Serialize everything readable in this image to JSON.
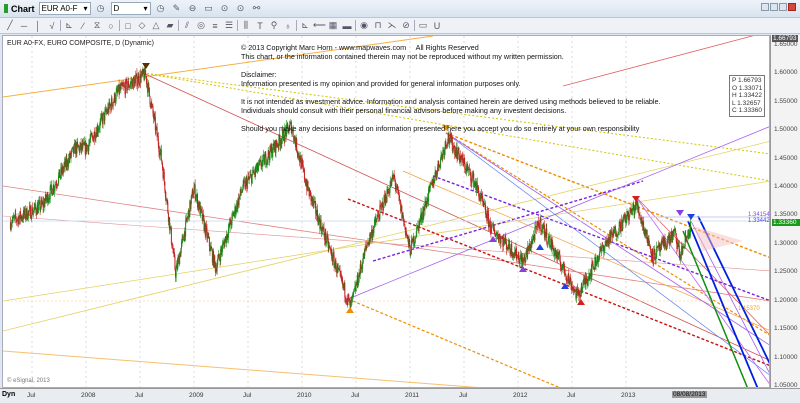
{
  "window": {
    "title": "Chart",
    "symbol_input": "EUR A0-F",
    "interval_input": "D"
  },
  "toolbar": {
    "tools": [
      "╱",
      "─",
      "│",
      "√",
      "⊾",
      "⁄",
      "⧖",
      "○",
      "□",
      "◇",
      "△",
      "▰",
      "⫽",
      "◎",
      "≡",
      "☰",
      "⫼",
      "T",
      "⚲",
      "♁",
      "⊾",
      "⟵",
      "▦",
      "▬",
      "◉",
      "⊓",
      "⋋",
      "⊘",
      "▭",
      "U"
    ]
  },
  "chart": {
    "symbol_label": "EUR A0-FX, EURO COMPOSITE, D (Dynamic)",
    "notice": "© 2013 Copyright Marc Horn - www.mapwaves.com     All Rights Reserved\nThis chart, or the information contained therein may not be reproduced without my written permission.\n\nDisclaimer:\nInformation presented is my opinion and provided for general information purposes only.\n\nIt is not intended as investment advice. Information and analysis contained herein are derived using methods believed to be reliable.\nIndividuals should consult with their personal financial advisors before making any investent decisions.\n\nShould you make any decisions based on information presented here you accept you do so entirely at your own responsibility",
    "ohlc": [
      "P 1.66793",
      "O 1.33071",
      "H 1.33422",
      "L 1.32657",
      "C 1.33360"
    ],
    "watermark": "© eSignal, 2013",
    "line_labels": [
      "1.34154",
      "1.33442",
      "1.15370"
    ],
    "last_price": "1.33360",
    "top_price": "1.66793",
    "colors": {
      "up": "#1a8a1a",
      "down": "#c02020",
      "last_price_bg": "#1a9a1a"
    }
  },
  "y_axis": {
    "ticks": [
      "1.65000",
      "1.60000",
      "1.55000",
      "1.50000",
      "1.45000",
      "1.40000",
      "1.35000",
      "1.30000",
      "1.25000",
      "1.20000",
      "1.15000",
      "1.10000",
      "1.05000"
    ]
  },
  "x_axis": {
    "mode_label": "Dyn",
    "ticks": [
      "Jul",
      "2008",
      "Jul",
      "2009",
      "Jul",
      "2010",
      "Jul",
      "2011",
      "Jul",
      "2012",
      "Jul",
      "2013"
    ],
    "current_date": "08/08/2013"
  },
  "chart_data": {
    "type": "line",
    "note_type": "candlestick",
    "x": [
      2007.3,
      2007.6,
      2007.9,
      2008.0,
      2008.3,
      2008.55,
      2008.7,
      2008.83,
      2009.0,
      2009.2,
      2009.45,
      2009.9,
      2010.05,
      2010.45,
      2010.6,
      2010.85,
      2011.0,
      2011.35,
      2011.6,
      2011.75,
      2012.05,
      2012.2,
      2012.55,
      2012.8,
      2013.1,
      2013.25,
      2013.45,
      2013.5,
      2013.6
    ],
    "values": [
      1.34,
      1.37,
      1.47,
      1.47,
      1.57,
      1.6,
      1.45,
      1.25,
      1.4,
      1.26,
      1.4,
      1.51,
      1.4,
      1.19,
      1.3,
      1.42,
      1.29,
      1.49,
      1.41,
      1.33,
      1.27,
      1.34,
      1.21,
      1.3,
      1.37,
      1.28,
      1.32,
      1.28,
      1.3336
    ],
    "ylim": [
      1.03,
      1.67
    ]
  }
}
